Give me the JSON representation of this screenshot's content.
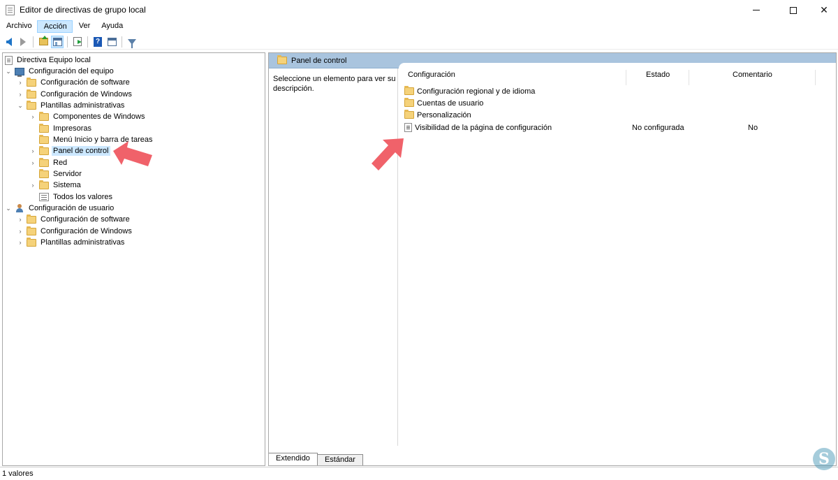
{
  "window": {
    "title": "Editor de directivas de grupo local"
  },
  "menubar": {
    "items": [
      "Archivo",
      "Acción",
      "Ver",
      "Ayuda"
    ],
    "active": "Acción"
  },
  "toolbar": {
    "icons": [
      "back-arrow-icon",
      "forward-arrow-icon",
      "up-folder-icon",
      "show-tree-icon",
      "export-list-icon",
      "help-icon",
      "properties-icon",
      "filter-icon"
    ]
  },
  "tree": {
    "items": [
      {
        "label": "Directiva Equipo local",
        "icon": "document-icon",
        "expander": ""
      },
      {
        "label": "Configuración del equipo",
        "icon": "computer-icon",
        "expander": "expanded"
      },
      {
        "label": "Configuración de software",
        "icon": "folder-icon",
        "expander": "collapsed"
      },
      {
        "label": "Configuración de Windows",
        "icon": "folder-icon",
        "expander": "collapsed"
      },
      {
        "label": "Plantillas administrativas",
        "icon": "folder-icon",
        "expander": "expanded"
      },
      {
        "label": "Componentes de Windows",
        "icon": "folder-icon",
        "expander": "collapsed"
      },
      {
        "label": "Impresoras",
        "icon": "folder-icon",
        "expander": ""
      },
      {
        "label": "Menú Inicio y barra de tareas",
        "icon": "folder-icon",
        "expander": ""
      },
      {
        "label": "Panel de control",
        "icon": "folder-icon",
        "expander": "collapsed",
        "selected": true
      },
      {
        "label": "Red",
        "icon": "folder-icon",
        "expander": "collapsed"
      },
      {
        "label": "Servidor",
        "icon": "folder-icon",
        "expander": ""
      },
      {
        "label": "Sistema",
        "icon": "folder-icon",
        "expander": "collapsed"
      },
      {
        "label": "Todos los valores",
        "icon": "all-settings-icon",
        "expander": ""
      },
      {
        "label": "Configuración de usuario",
        "icon": "user-icon",
        "expander": "expanded"
      },
      {
        "label": "Configuración de software",
        "icon": "folder-icon",
        "expander": "collapsed"
      },
      {
        "label": "Configuración de Windows",
        "icon": "folder-icon",
        "expander": "collapsed"
      },
      {
        "label": "Plantillas administrativas",
        "icon": "folder-icon",
        "expander": "collapsed"
      }
    ]
  },
  "details": {
    "header_title": "Panel de control",
    "description": "Seleccione un elemento para ver su descripción.",
    "columns": {
      "configuracion": "Configuración",
      "estado": "Estado",
      "comentario": "Comentario"
    },
    "rows": [
      {
        "name": "Configuración regional y de idioma",
        "icon": "folder-icon",
        "estado": "",
        "comentario": ""
      },
      {
        "name": "Cuentas de usuario",
        "icon": "folder-icon",
        "estado": "",
        "comentario": ""
      },
      {
        "name": "Personalización",
        "icon": "folder-icon",
        "estado": "",
        "comentario": ""
      },
      {
        "name": "Visibilidad de la página de configuración",
        "icon": "setting-icon",
        "estado": "No configurada",
        "comentario": "No"
      }
    ],
    "tabs": [
      "Extendido",
      "Estándar"
    ],
    "active_tab": "Extendido"
  },
  "statusbar": {
    "text": "1 valores"
  },
  "colors": {
    "annotation_arrow": "#f0626a",
    "header_bar": "#a9c4de",
    "selection": "#cce8ff"
  }
}
